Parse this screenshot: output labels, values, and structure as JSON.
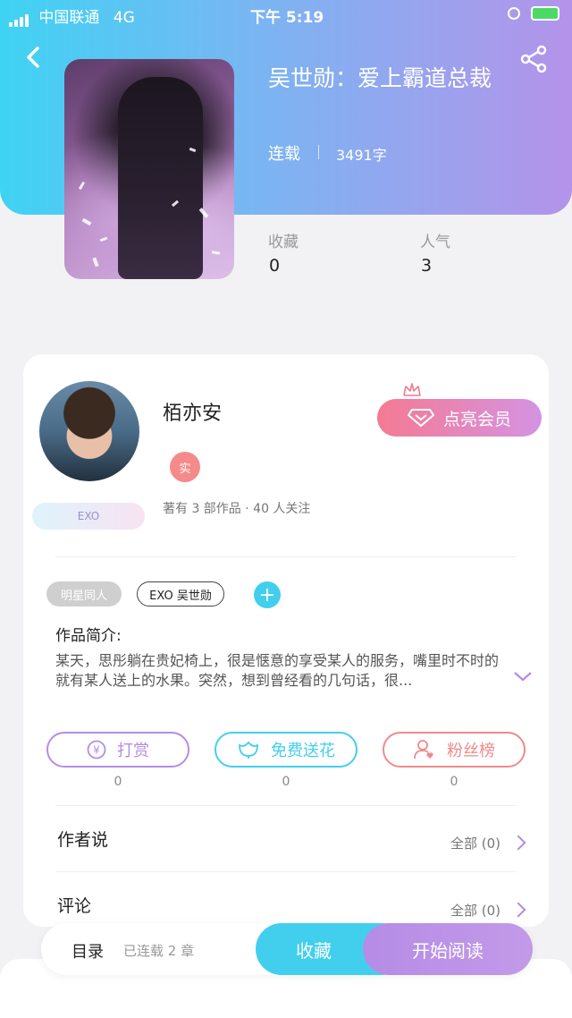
{
  "status_bar": {
    "carrier": "中国联通",
    "network": "4G",
    "time": "下午 5:19"
  },
  "book": {
    "title": "吴世勋：爱上霸道总裁",
    "status": "连载",
    "word_count": "3491字",
    "favorites_label": "收藏",
    "favorites_value": "0",
    "popularity_label": "人气",
    "popularity_value": "3"
  },
  "author": {
    "name": "栢亦安",
    "badge": "实",
    "fan_badge": "EXO",
    "stats": "著有 3 部作品 · 40 人关注",
    "vip_label": "点亮会员"
  },
  "tags": [
    "明星同人",
    "EXO 吴世勋"
  ],
  "intro": {
    "heading": "作品简介:",
    "text": "某天，思彤躺在贵妃椅上，很是惬意的享受某人的服务，嘴里时不时的就有某人送上的水果。突然，想到曾经看的几句话，很..."
  },
  "actions": [
    {
      "label": "打赏",
      "count": "0",
      "color": "#b58ce6"
    },
    {
      "label": "免费送花",
      "count": "0",
      "color": "#42cfee"
    },
    {
      "label": "粉丝榜",
      "count": "0",
      "color": "#f08a8a"
    }
  ],
  "author_says": {
    "title": "作者说",
    "more": "全部 (0)"
  },
  "comments": {
    "title": "评论",
    "more": "全部 (0)"
  },
  "bottom": {
    "catalog": "目录",
    "chapters": "已连载 2 章",
    "favorite": "收藏",
    "read": "开始阅读"
  },
  "colors": {
    "header_start": "#3fd3f3",
    "header_end": "#b493ea",
    "accent": "#b58ce6"
  }
}
